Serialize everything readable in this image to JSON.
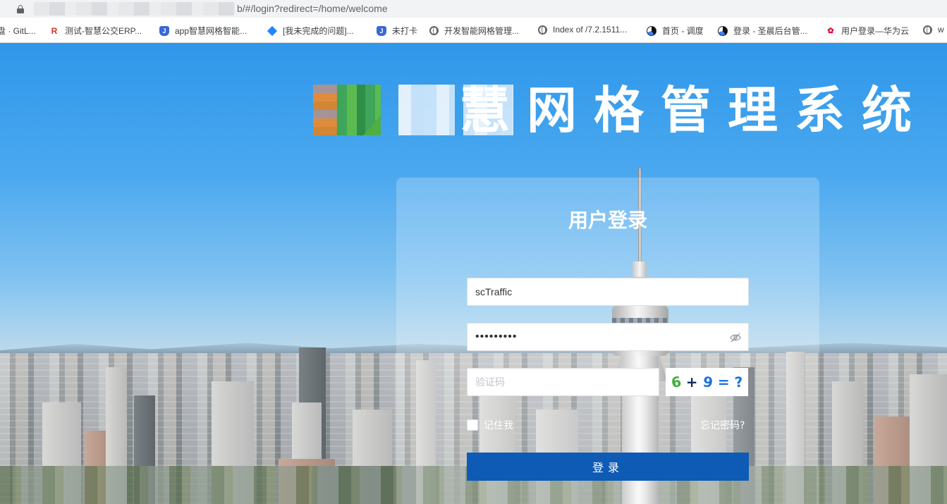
{
  "browser": {
    "url_suffix": "b/#/login?redirect=/home/welcome",
    "bookmarks": [
      {
        "label": "盘 · GitL...",
        "icon": "gitlab-icon"
      },
      {
        "label": "测试-智慧公交ERP...",
        "icon": "r-logo-icon"
      },
      {
        "label": "app智慧网格智能...",
        "icon": "jira-icon"
      },
      {
        "label": "[我未完成的问题]...",
        "icon": "jira-diamond-icon"
      },
      {
        "label": "未打卡",
        "icon": "jira-icon"
      },
      {
        "label": "开发智能网格管理...",
        "icon": "globe-icon"
      },
      {
        "label": "Index of /7.2.1511...",
        "icon": "globe-icon"
      },
      {
        "label": "首页 - 调度",
        "icon": "tapd-icon"
      },
      {
        "label": "登录 - 圣晨后台管...",
        "icon": "tapd-icon"
      },
      {
        "label": "用户登录—华为云",
        "icon": "huawei-icon"
      },
      {
        "label": "w",
        "icon": "globe-icon"
      }
    ]
  },
  "header": {
    "app_title": "慧网格管理系统"
  },
  "login": {
    "title": "用户登录",
    "username_value": "scTraffic",
    "password_value": "•••••••••",
    "captcha_placeholder": "验证码",
    "captcha_chars": [
      "6",
      "+",
      "9",
      "=",
      "?"
    ],
    "remember_label": "记住我",
    "forgot_label": "忘记密码?",
    "submit_label": "登录"
  },
  "colors": {
    "primary_button": "#0d5bb5",
    "sky": "#2f97ea"
  }
}
